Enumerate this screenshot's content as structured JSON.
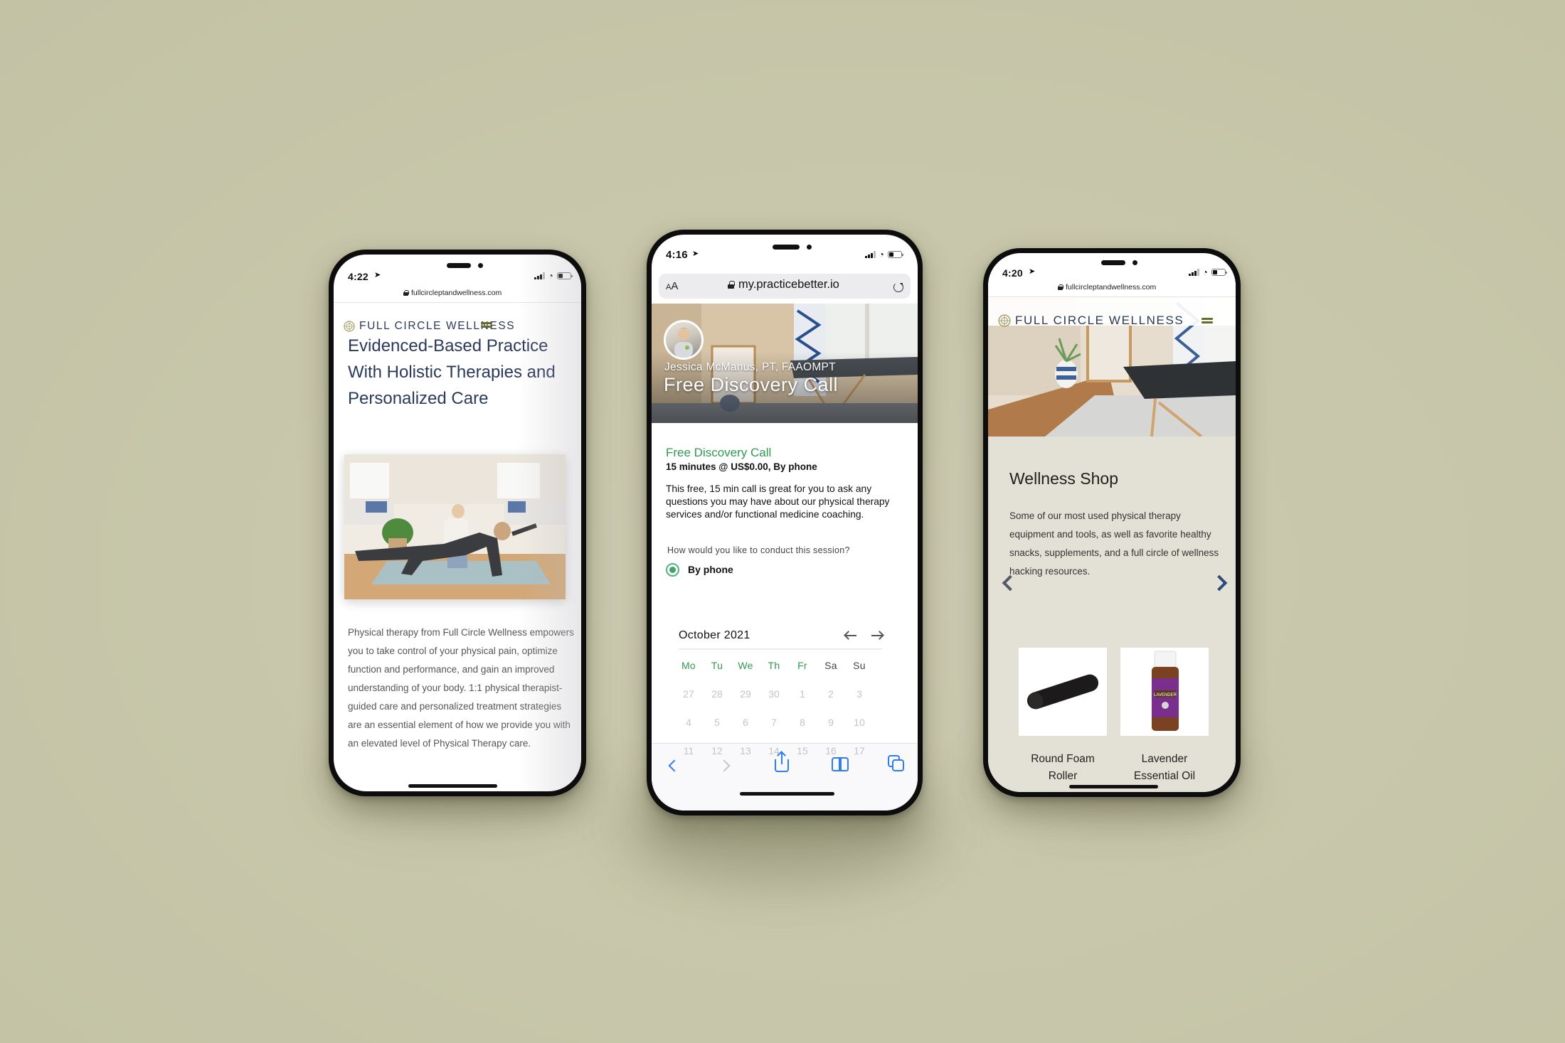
{
  "phones": [
    {
      "id": "home",
      "status": {
        "time": "4:22"
      },
      "url": "fullcircleptandwellness.com",
      "brand": "FULL CIRCLE WELLNESS",
      "heading_lines": [
        "Evidenced-Based Practice",
        "With Holistic Therapies and",
        "Personalized Care"
      ],
      "image_alt": "Physical therapist guiding a client through a bird-dog exercise on a yoga mat",
      "paragraph": "Physical therapy from Full Circle Wellness empowers you to take control of your physical pain, optimize function and performance, and gain an improved understanding of your body. 1:1 physical therapist-guided care and personalized treatment strategies are an essential element of how we provide you with an elevated level of Physical Therapy care."
    },
    {
      "id": "booking",
      "status": {
        "time": "4:16"
      },
      "url_bar": {
        "text_size_label": "AA",
        "url": "my.practicebetter.io"
      },
      "hero": {
        "practitioner": "Jessica McManus, PT, FAAOMPT",
        "title": "Free Discovery Call"
      },
      "service": {
        "title": "Free Discovery Call",
        "meta": "15 minutes @ US$0.00, By phone",
        "description": "This  free, 15 min call is great for you to ask any questions you may have about our  physical therapy services and/or functional medicine coaching."
      },
      "session_question": "How would you like to conduct this session?",
      "session_option": {
        "label": "By phone",
        "selected": true
      },
      "calendar": {
        "month_label": "October 2021",
        "weekdays": [
          "Mo",
          "Tu",
          "We",
          "Th",
          "Fr",
          "Sa",
          "Su"
        ],
        "weeks": [
          [
            "27",
            "28",
            "29",
            "30",
            "1",
            "2",
            "3"
          ],
          [
            "4",
            "5",
            "6",
            "7",
            "8",
            "9",
            "10"
          ],
          [
            "11",
            "12",
            "13",
            "14",
            "15",
            "16",
            "17"
          ]
        ]
      },
      "toolbar": [
        "back-icon",
        "forward-icon",
        "share-icon",
        "bookmarks-icon",
        "tabs-icon"
      ]
    },
    {
      "id": "shop",
      "status": {
        "time": "4:20"
      },
      "url": "fullcircleptandwellness.com",
      "brand": "FULL CIRCLE WELLNESS",
      "hero_alt": "Treatment room with massage table, chair and plant",
      "shop_title": "Wellness Shop",
      "shop_description": "Some of our most used physical therapy equipment and tools, as well as favorite healthy snacks, supplements, and a full circle of wellness hacking resources.",
      "products": [
        {
          "name_lines": [
            "Round Foam",
            "Roller"
          ]
        },
        {
          "name_lines": [
            "Lavender",
            "Essential Oil"
          ],
          "label_text": "LAVENDER"
        }
      ]
    }
  ],
  "colors": {
    "background": "#c8c7ac",
    "brand_navy": "#2b3a5a",
    "brand_olive": "#6b6a2a",
    "booking_green": "#2f9a4f",
    "ios_blue": "#2e7cf6",
    "shop_beige": "#e3e1d6"
  }
}
